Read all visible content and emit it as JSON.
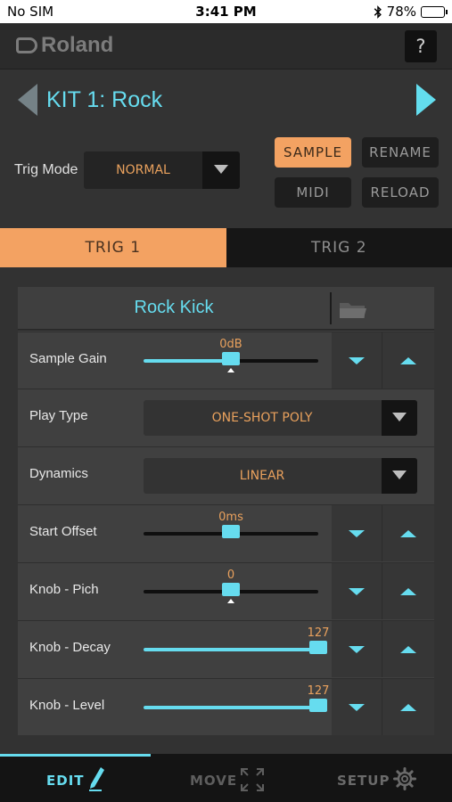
{
  "status_bar": {
    "carrier": "No SIM",
    "time": "3:41 PM",
    "battery": "78%",
    "battery_level": 0.78
  },
  "brand": {
    "logo": "Roland",
    "help_label": "?"
  },
  "kit": {
    "title": "KIT 1: Rock",
    "trig_mode_label": "Trig Mode",
    "trig_mode_value": "NORMAL"
  },
  "buttons": {
    "sample": "SAMPLE",
    "rename": "RENAME",
    "midi": "MIDI",
    "reload": "RELOAD"
  },
  "tabs": [
    {
      "label": "TRIG 1",
      "active": true
    },
    {
      "label": "TRIG 2",
      "active": false
    }
  ],
  "sample": {
    "name": "Rock Kick"
  },
  "params": {
    "sample_gain": {
      "label": "Sample Gain",
      "value": "0dB",
      "level": 0.5
    },
    "play_type": {
      "label": "Play Type",
      "value": "ONE-SHOT POLY"
    },
    "dynamics": {
      "label": "Dynamics",
      "value": "LINEAR"
    },
    "start_offset": {
      "label": "Start Offset",
      "value": "0ms",
      "level": 0.5
    },
    "knob_pich": {
      "label": "Knob - Pich",
      "value": "0",
      "level": 0.5
    },
    "knob_decay": {
      "label": "Knob - Decay",
      "value": "127",
      "level": 1.0
    },
    "knob_level": {
      "label": "Knob - Level",
      "value": "127",
      "level": 1.0
    }
  },
  "nav": {
    "edit": "EDIT",
    "move": "MOVE",
    "setup": "SETUP"
  },
  "colors": {
    "accent": "#66dcef",
    "orange": "#f3a262",
    "value_text": "#e9a15d"
  }
}
